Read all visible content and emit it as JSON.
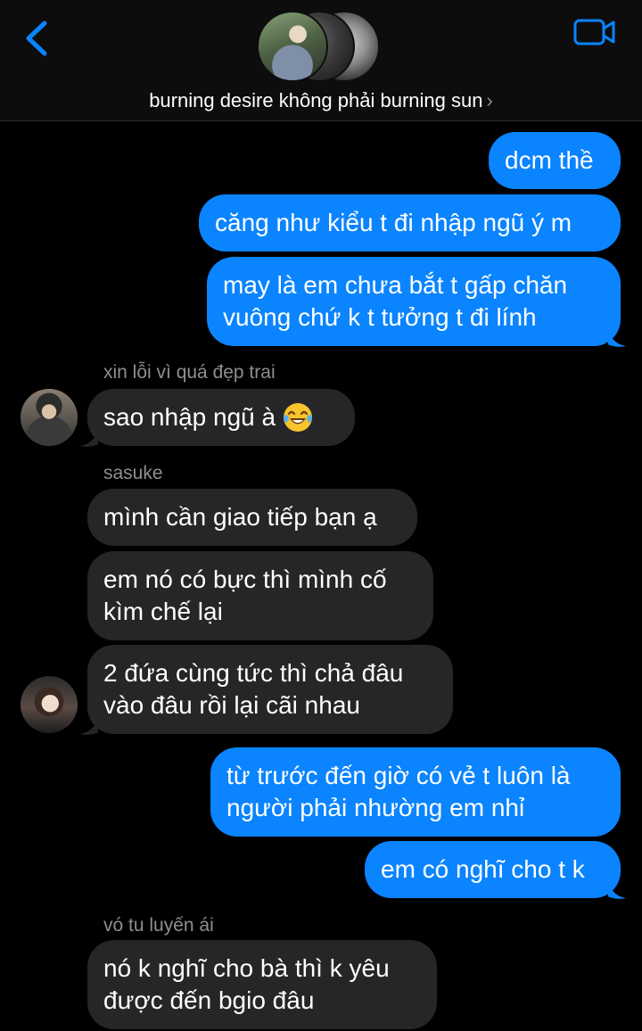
{
  "header": {
    "group_name": "burning desire không phải burning sun",
    "chevron": "›",
    "back_icon": "chevron-left-icon",
    "video_icon": "video-camera-icon",
    "accent_color": "#0a84ff"
  },
  "messages": [
    {
      "from": "me",
      "text": "dcm thề"
    },
    {
      "from": "me",
      "text": "căng như kiểu t đi nhập ngũ ý m"
    },
    {
      "from": "me",
      "lines": [
        "may là em chưa bắt t gấp chăn",
        "vuông chứ k t tưởng t đi lính"
      ]
    },
    {
      "from": "them",
      "sender": "xin lỗi vì quá đẹp trai",
      "text": "sao nhập ngũ à",
      "emoji": "face-with-tears-of-joy-icon"
    },
    {
      "from": "them",
      "sender": "sasuke",
      "text": "mình cần giao tiếp bạn ạ"
    },
    {
      "from": "them",
      "lines": [
        "em nó có bực thì mình cố",
        "kìm chế lại"
      ]
    },
    {
      "from": "them",
      "lines": [
        "2 đứa cùng tức thì chả đâu",
        "vào đâu rồi lại cãi nhau"
      ]
    },
    {
      "from": "me",
      "lines": [
        "từ trước đến giờ có vẻ t luôn là",
        "người phải nhường em nhỉ"
      ]
    },
    {
      "from": "me",
      "text": "em có nghĩ cho t k"
    },
    {
      "from": "them",
      "sender": "vó tu luyến ái",
      "lines": [
        "nó k nghĩ cho bà thì k yêu",
        "được đến bgio đâu"
      ]
    }
  ]
}
